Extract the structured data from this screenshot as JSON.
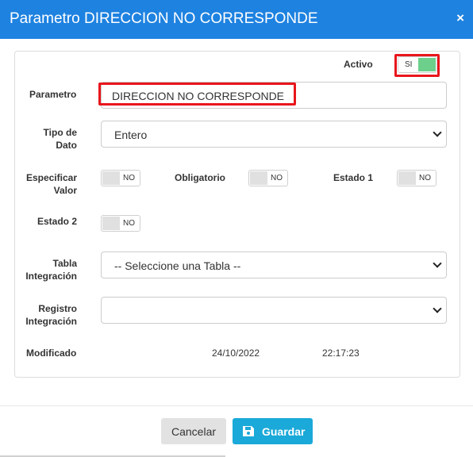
{
  "dialog": {
    "title": "Parametro DIRECCION NO CORRESPONDE",
    "close_symbol": "×"
  },
  "form": {
    "activo": {
      "label": "Activo",
      "toggle_text": "SI",
      "on": true
    },
    "parametro": {
      "label": "Parametro",
      "value": "DIRECCION NO CORRESPONDE"
    },
    "tipo_dato": {
      "label_line1": "Tipo de",
      "label_line2": "Dato",
      "selected": "Entero"
    },
    "especificar_valor": {
      "label_line1": "Especificar",
      "label_line2": "Valor",
      "toggle_text": "NO",
      "on": false
    },
    "obligatorio": {
      "label": "Obligatorio",
      "toggle_text": "NO",
      "on": false
    },
    "estado1": {
      "label": "Estado 1",
      "toggle_text": "NO",
      "on": false
    },
    "estado2": {
      "label": "Estado 2",
      "toggle_text": "NO",
      "on": false
    },
    "tabla_integracion": {
      "label_line1": "Tabla",
      "label_line2": "Integración",
      "selected": "-- Seleccione una Tabla --"
    },
    "registro_integracion": {
      "label_line1": "Registro",
      "label_line2": "Integración",
      "selected": ""
    },
    "modificado": {
      "label": "Modificado",
      "date": "24/10/2022",
      "time": "22:17:23"
    }
  },
  "footer": {
    "cancel_label": "Cancelar",
    "save_label": "Guardar"
  },
  "icons": {
    "close": "close-icon",
    "chevron": "chevron-down-icon",
    "save": "save-icon"
  },
  "colors": {
    "header": "#1e82e0",
    "highlight": "#e8161c",
    "toggle_on": "#6ccf8b",
    "save_button": "#1aa9d8"
  }
}
